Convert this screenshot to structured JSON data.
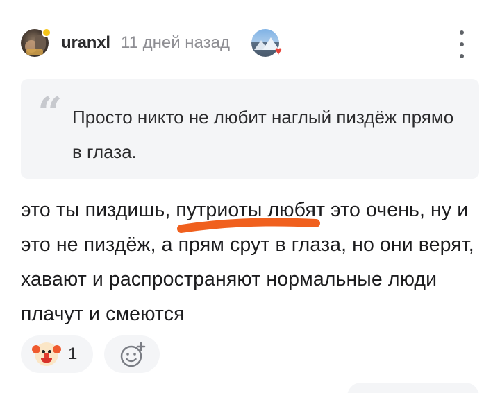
{
  "comment": {
    "username": "uranxl",
    "time": "11 дней назад",
    "quote_text": "Просто никто не любит наглый пиздёж прямо в глаза.",
    "body": "это ты пиздишь, путриоты любят это очень, ну и это не пиздёж, а прям срут в глаза, но они верят, хавают и распространяют нормальные люди плачут и смеются"
  },
  "reactions": {
    "items": [
      {
        "icon": "clown-face-icon",
        "count": "1"
      }
    ],
    "add_icon": "add-emoji-icon"
  },
  "icons": {
    "menu": "more-vertical-icon",
    "quote": "quote-icon",
    "badge": "mountain-badge-icon"
  },
  "colors": {
    "quote_bg": "#f4f5f7",
    "highlight_stroke": "#f0601e",
    "online_dot": "#f5c518"
  }
}
